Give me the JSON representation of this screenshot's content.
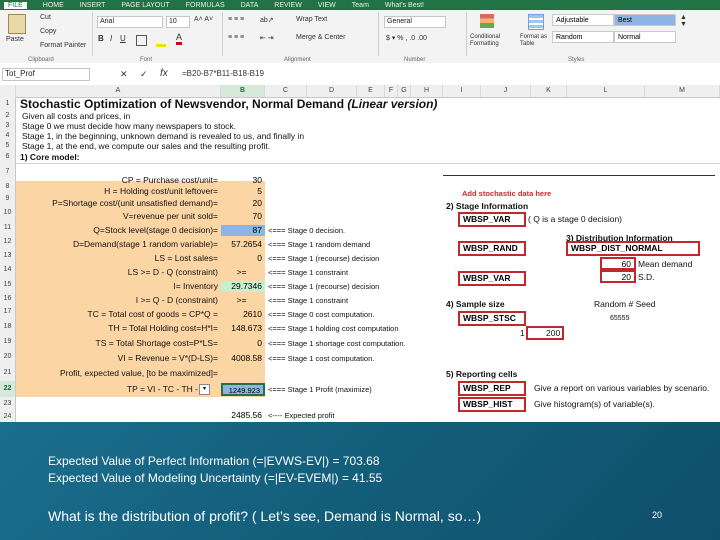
{
  "ribbon": {
    "tabs": [
      "FILE",
      "HOME",
      "INSERT",
      "PAGE LAYOUT",
      "FORMULAS",
      "DATA",
      "REVIEW",
      "VIEW",
      "Team",
      "What's Best!"
    ],
    "clipboard": {
      "paste": "Paste",
      "cut": "Cut",
      "copy": "Copy",
      "format_painter": "Format Painter",
      "group": "Clipboard"
    },
    "font": {
      "name": "Arial",
      "size": "10",
      "group": "Font"
    },
    "alignment": {
      "wrap": "Wrap Text",
      "merge": "Merge & Center",
      "group": "Alignment"
    },
    "number": {
      "format": "General",
      "group": "Number"
    },
    "styles": {
      "conditional": "Conditional Formatting",
      "format_table": "Format as Table",
      "adjustable": "Adjustable",
      "best": "Best",
      "random": "Random",
      "normal": "Normal",
      "group": "Styles"
    }
  },
  "formula_bar": {
    "name_box": "Tot_Prof",
    "fx": "fx",
    "formula": "=B20-B7*B11-B18-B19"
  },
  "columns": [
    "A",
    "B",
    "C",
    "D",
    "E",
    "F",
    "G",
    "H",
    "I",
    "J",
    "K",
    "L",
    "M"
  ],
  "selected_column": "B",
  "rows": [
    "1",
    "2",
    "3",
    "4",
    "5",
    "6",
    "7",
    "8",
    "9",
    "10",
    "11",
    "12",
    "13",
    "14",
    "15",
    "16",
    "17",
    "18",
    "19",
    "20",
    "21",
    "22",
    "23",
    "24"
  ],
  "selected_row": "22",
  "sheet": {
    "title": "Stochastic Optimization of Newsvendor, Normal Demand",
    "title_suffix": "(Linear version)",
    "intro": [
      "Given all costs and prices, in",
      "Stage 0 we must decide how many newspapers to stock.",
      "Stage 1, in the beginning, unknown demand is revealed to us, and finally in",
      "Stage 1, at the end, we compute our sales and the resulting profit."
    ],
    "core_model": "1) Core model:",
    "labels": [
      "CP = Purchase cost/unit=",
      "H = Holding cost/unit leftover=",
      "P=Shortage cost/(unit unsatisfied demand)=",
      "V=revenue per unit sold=",
      "Q=Stock level(stage 0 decision)=",
      "D=Demand(stage 1 random variable)=",
      "LS = Lost sales=",
      "LS >= D - Q (constraint)",
      "I= Inventory",
      "I >= Q - D (constraint)",
      "TC = Total cost of goods = CP*Q =",
      "TH = Total Holding cost=H*I=",
      "TS = Total Shortage cost=P*LS=",
      "VI = Revenue = V*(D-LS)=",
      "Profit, expected value, [to be maximized]=",
      "TP = VI - TC - TH -"
    ],
    "values": [
      "30",
      "5",
      "20",
      "70",
      "87",
      "57.2654",
      "0",
      ">=",
      "29.7346",
      ">=",
      "2610",
      "148.673",
      "0",
      "4008.58",
      "",
      "1249.923"
    ],
    "row24_value": "2485.56",
    "row24_note": "<---- Expected profit",
    "comments": [
      "<=== Stage 0 decision.",
      "<=== Stage 1 random demand",
      "<=== Stage 1 (recourse) decision",
      "<=== Stage 1 constraint",
      "<=== Stage 1 (recourse) decision",
      "<=== Stage 1 constraint",
      "<=== Stage 0 cost computation.",
      "<=== Stage 1 holding cost computation",
      "<=== Stage 1 shortage cost computation.",
      "<=== Stage 1 cost computation.",
      "<=== Stage 1 Profit (maximize)"
    ],
    "add_note": "Add stochastic data here",
    "stage_info": "2) Stage Information",
    "wbsp_var": "WBSP_VAR",
    "q_note": "( Q is a stage 0 decision)",
    "dist_info": "3) Distribution Information",
    "wbsp_rand": "WBSP_RAND",
    "wbsp_dist_normal": "WBSP_DIST_NORMAL",
    "mean_val": "60",
    "mean_label": "Mean demand",
    "sd_val": "20",
    "sd_label": "S.D.",
    "wbsp_var2": "WBSP_VAR",
    "sample_size": "4) Sample size",
    "random_seed": "Random # Seed",
    "wbsp_stsc": "WBSP_STSC",
    "seed_val": "65555",
    "stsc_a": "1",
    "stsc_b": "200",
    "reporting": "5) Reporting cells",
    "wbsp_rep": "WBSP_REP",
    "rep_desc": "Give a report on various variables by scenario.",
    "wbsp_hist": "WBSP_HIST",
    "hist_desc": "Give histogram(s) of variable(s)."
  },
  "overlay": {
    "line1": "Expected Value of Perfect Information (=|EVWS-EV|)  = 703.68",
    "line2": "Expected Value of Modeling Uncertainty (=|EV-EVEM|) =  41.55",
    "question": "What is the distribution of profit?  ( Let’s see, Demand is Normal, so…)",
    "page": "20"
  }
}
